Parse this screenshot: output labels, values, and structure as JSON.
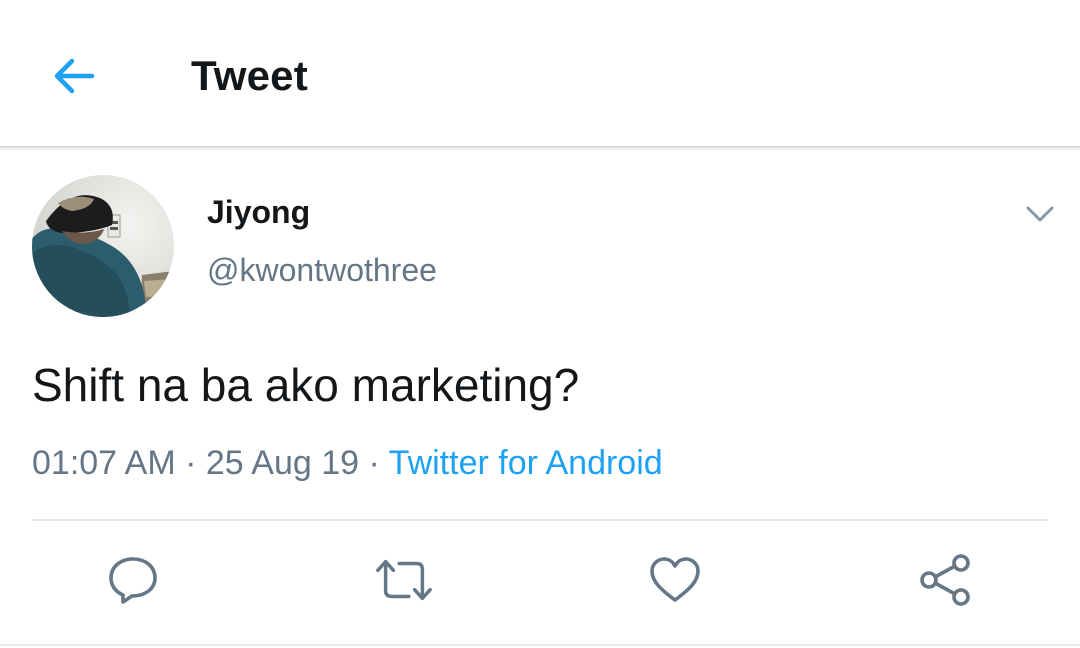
{
  "header": {
    "title": "Tweet",
    "back_icon": "arrow-left-icon",
    "accent_color": "#1da1f2"
  },
  "tweet": {
    "author": {
      "display_name": "Jiyong",
      "handle": "@kwontwothree",
      "avatar_icon": "profile-photo"
    },
    "text": "Shift na ba ako marketing?",
    "time": "01:07 AM",
    "separator": "·",
    "date": "25 Aug 19",
    "source": "Twitter for Android"
  },
  "actions": [
    {
      "name": "reply",
      "icon": "reply-icon"
    },
    {
      "name": "retweet",
      "icon": "retweet-icon"
    },
    {
      "name": "like",
      "icon": "heart-icon"
    },
    {
      "name": "share",
      "icon": "share-icon"
    }
  ],
  "colors": {
    "text_primary": "#14171a",
    "text_secondary": "#657786",
    "link": "#1da1f2",
    "icon_gray": "#657786"
  }
}
